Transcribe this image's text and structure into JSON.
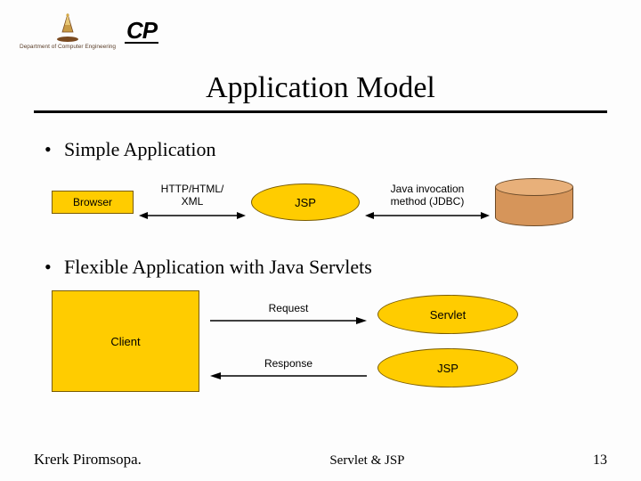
{
  "header": {
    "dept_caption": "Department of Computer Engineering",
    "cp_logo_text": "CP"
  },
  "title": "Application Model",
  "bullets": {
    "b1": "Simple Application",
    "b2": "Flexible Application with Java Servlets"
  },
  "diagram1": {
    "browser": "Browser",
    "conn1_label": "HTTP/HTML/\nXML",
    "jsp": "JSP",
    "conn2_label": "Java invocation\nmethod (JDBC)"
  },
  "diagram2": {
    "client": "Client",
    "request": "Request",
    "response": "Response",
    "servlet": "Servlet",
    "jsp": "JSP"
  },
  "footer": {
    "author": "Krerk Piromsopa.",
    "center": "Servlet & JSP",
    "page": "13"
  },
  "colors": {
    "box_fill": "#ffcc00",
    "cyl_fill": "#d6955a"
  }
}
